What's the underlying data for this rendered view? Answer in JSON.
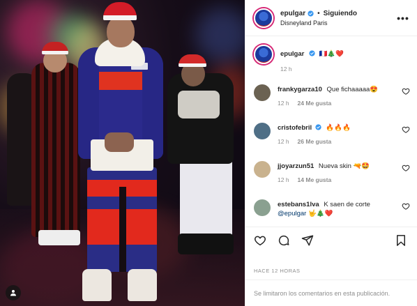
{
  "header": {
    "username": "epulgar",
    "separator": "•",
    "follow_label": "Siguiendo",
    "location": "Disneyland Paris",
    "more_icon": "ellipsis-icon"
  },
  "caption": {
    "username": "epulgar",
    "text": "🇫🇷🎄❤️",
    "time": "12 h"
  },
  "comments": [
    {
      "username": "frankygarza10",
      "text": "Que fichaaaaa😍",
      "time": "12 h",
      "likes": "24 Me gusta",
      "avatar_color": "#6b6252"
    },
    {
      "username": "cristofebril",
      "text": "🔥🔥🔥",
      "verified": true,
      "time": "12 h",
      "likes": "26 Me gusta",
      "avatar_color": "#4f6f86"
    },
    {
      "username": "jjoyarzun51",
      "text": "Nueva skin 🔫🤩",
      "time": "12 h",
      "likes": "14 Me gusta",
      "avatar_color": "#c9b28e"
    },
    {
      "username": "estebans1lva",
      "text": "K saen de corte",
      "mention": "@epulgar",
      "suffix": "🤟🎄❤️",
      "time": "",
      "likes": "",
      "avatar_color": "#8aa090"
    }
  ],
  "actions": {
    "like_icon": "heart-icon",
    "comment_icon": "comment-icon",
    "share_icon": "paper-plane-icon",
    "save_icon": "bookmark-icon"
  },
  "post_time": "HACE 12 HORAS",
  "comments_limited": "Se limitaron los comentarios en esta publicación.",
  "colors": {
    "verified": "#3897f0",
    "text": "#262626",
    "muted": "#8e8e8e",
    "mention": "#00376b"
  }
}
